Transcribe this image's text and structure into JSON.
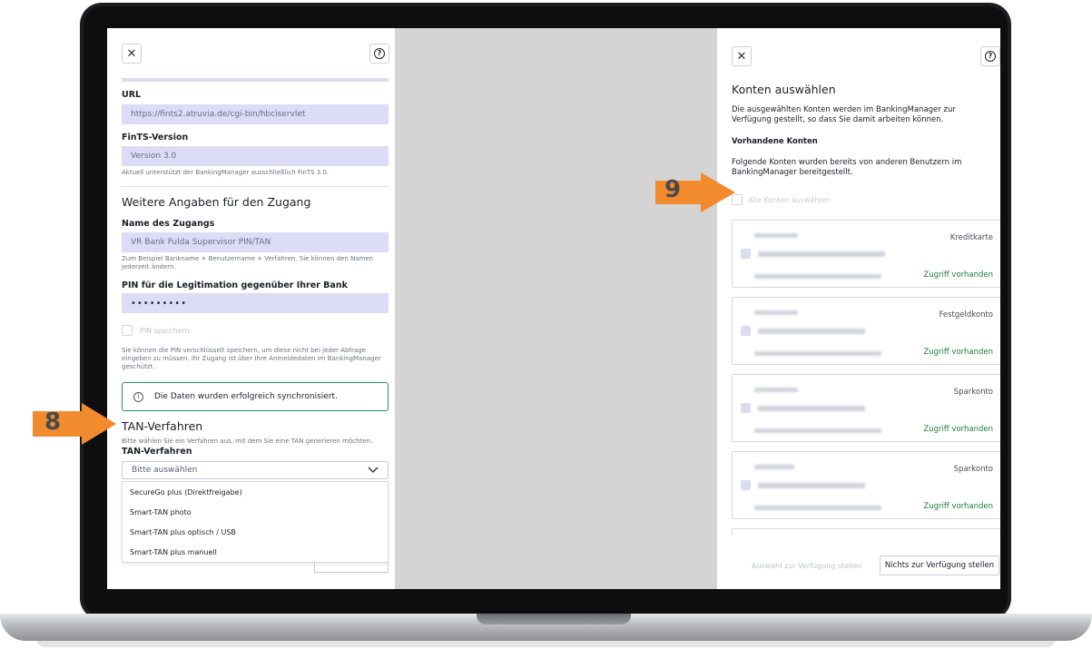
{
  "left_panel": {
    "url_label": "URL",
    "url_value": "https://fints2.atruvia.de/cgi-bin/hbciservlet",
    "fints_label": "FinTS-Version",
    "fints_value": "Version 3.0",
    "fints_hint": "Aktuell unterstützt der BankingManager ausschließlich FinTS 3.0.",
    "section_title": "Weitere Angaben für den Zugang",
    "name_label": "Name des Zugangs",
    "name_value": "VR Bank Fulda Supervisor PIN/TAN",
    "name_hint_1": "Zum Beispiel Bankname + Benutzername + Verfahren. Sie können den Namen",
    "name_hint_2": "jederzeit ändern.",
    "pin_label": "PIN für die Legitimation gegenüber Ihrer Bank",
    "pin_value": "•••••••••",
    "pin_save_label": "PIN speichern",
    "pin_hint_1": "Sie können die PIN verschlüsselt speichern, um diese nicht bei jeder Abfrage",
    "pin_hint_2": "eingeben zu müssen. Ihr Zugang ist über Ihre Anmeldedaten im BankingManager",
    "pin_hint_3": "geschützt.",
    "success_message": "Die Daten wurden erfolgreich synchronisiert.",
    "tan_title": "TAN-Verfahren",
    "tan_hint": "Bitte wählen Sie ein Verfahren aus, mit dem Sie eine TAN generieren möchten.",
    "tan_label": "TAN-Verfahren",
    "tan_select_placeholder": "Bitte auswählen",
    "tan_options": [
      "SecureGo plus (Direktfreigabe)",
      "Smart-TAN photo",
      "Smart-TAN plus optisch / USB",
      "Smart-TAN plus manuell"
    ]
  },
  "right_panel": {
    "title": "Konten auswählen",
    "intro_1": "Die ausgewählten Konten werden im BankingManager zur",
    "intro_2": "Verfügung gestellt, so dass Sie damit arbeiten können.",
    "existing_title": "Vorhandene Konten",
    "existing_text_1": "Folgende Konten wurden bereits von anderen Benutzern im",
    "existing_text_2": "BankingManager bereitgestellt.",
    "select_all_label": "Alle Konten auswählen",
    "accounts": [
      {
        "type": "Kreditkarte",
        "access": "Zugriff vorhanden"
      },
      {
        "type": "Festgeldkonto",
        "access": "Zugriff vorhanden"
      },
      {
        "type": "Sparkonto",
        "access": "Zugriff vorhanden"
      },
      {
        "type": "Sparkonto",
        "access": "Zugriff vorhanden"
      }
    ],
    "provide_selection_label": "Auswahl zur Verfügung stellen",
    "provide_none_label": "Nichts zur Verfügung stellen"
  },
  "annotations": {
    "arrow_8": "8",
    "arrow_9": "9"
  },
  "icons": {
    "close": "close-icon",
    "help": "help-icon",
    "info": "info-icon",
    "chevron": "chevron-down-icon"
  },
  "colors": {
    "field_bg": "#dcdcf7",
    "success_border": "#2e8b57",
    "access_green": "#1f7a3f",
    "arrow_orange": "#f28a2e"
  }
}
